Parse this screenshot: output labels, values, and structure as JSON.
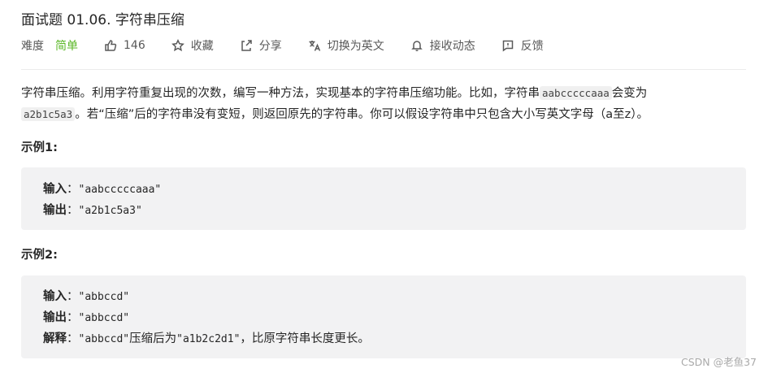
{
  "problem": {
    "title": "面试题 01.06. 字符串压缩"
  },
  "meta": {
    "difficulty_label": "难度",
    "difficulty_value": "简单",
    "like_count": "146",
    "favorite_label": "收藏",
    "share_label": "分享",
    "switch_lang_label": "切换为英文",
    "notify_label": "接收动态",
    "feedback_label": "反馈"
  },
  "description": {
    "part1": "字符串压缩。利用字符重复出现的次数，编写一种方法，实现基本的字符串压缩功能。比如，字符串",
    "code1": "aabcccccaaa",
    "part2": "会变为",
    "code2": "a2b1c5a3",
    "part3": "。若“压缩”后的字符串没有变短，则返回原先的字符串。你可以假设字符串中只包含大小写英文字母（a至z）。"
  },
  "examples": [
    {
      "heading": "示例1:",
      "input_label": "输入",
      "input_value": "\"aabcccccaaa\"",
      "output_label": "输出",
      "output_value": "\"a2b1c5a3\""
    },
    {
      "heading": "示例2:",
      "input_label": "输入",
      "input_value": "\"abbccd\"",
      "output_label": "输出",
      "output_value": "\"abbccd\"",
      "explain_label": "解释",
      "explain_value_a": "\"abbccd\"",
      "explain_text_mid": "压缩后为",
      "explain_value_b": "\"a1b2c2d1\"",
      "explain_text_end": "，比原字符串长度更长。"
    }
  ],
  "colon": "：",
  "watermark": "CSDN @老鱼37",
  "colors": {
    "difficulty_easy": "#5ab726",
    "code_bg": "#f2f2f3"
  },
  "icons": [
    "thumbs-up-icon",
    "star-icon",
    "share-icon",
    "translate-icon",
    "bell-icon",
    "feedback-icon"
  ]
}
